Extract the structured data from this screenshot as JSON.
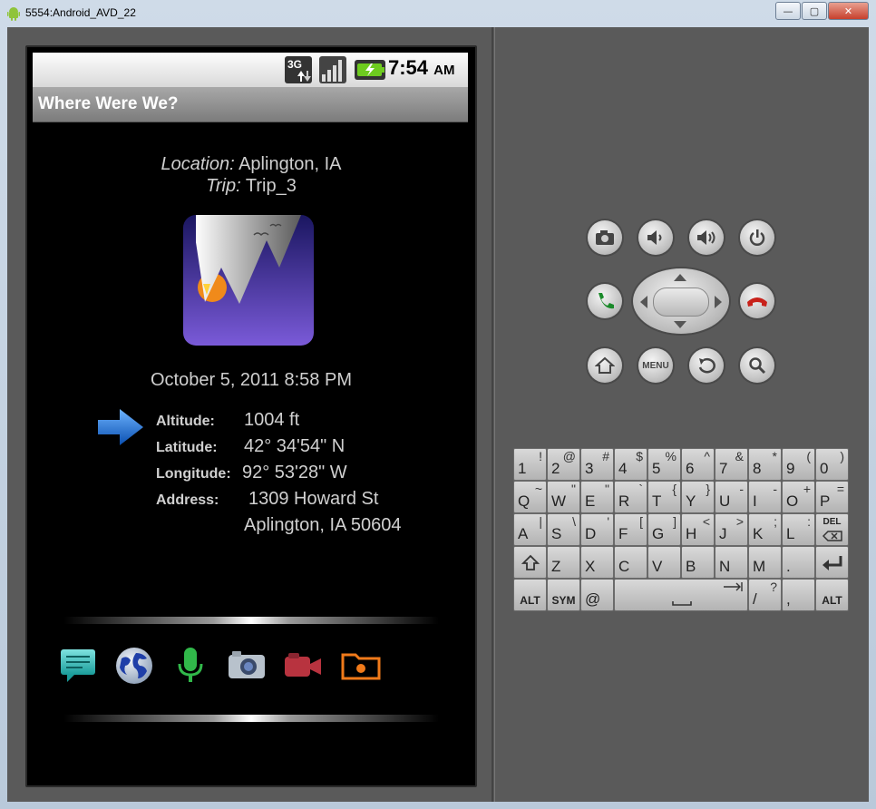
{
  "window": {
    "title": "5554:Android_AVD_22",
    "minimize_glyph": "—",
    "maximize_glyph": "▢",
    "close_glyph": "✕"
  },
  "status_bar": {
    "network": "3G",
    "time": "7:54",
    "ampm": "AM"
  },
  "app": {
    "title": "Where Were We?"
  },
  "location": {
    "label": "Location:",
    "value": "Aplington, IA",
    "trip_label": "Trip:",
    "trip_value": "Trip_3"
  },
  "datetime": "October 5, 2011 8:58 PM",
  "details": {
    "altitude_label": "Altitude:",
    "altitude_value": "1004 ft",
    "latitude_label": "Latitude:",
    "latitude_value": "42° 34'54\" N",
    "longitude_label": "Longitude:",
    "longitude_value": "92° 53'28\" W",
    "address_label": "Address:",
    "address_line1": "1309 Howard St",
    "address_line2": "Aplington, IA 50604"
  },
  "share_icons": [
    "message-icon",
    "globe-icon",
    "microphone-icon",
    "camera-icon",
    "video-camera-icon",
    "folder-icon"
  ],
  "controls": {
    "menu_label": "MENU"
  },
  "keyboard": {
    "row1": [
      [
        "1",
        "!"
      ],
      [
        "2",
        "@"
      ],
      [
        "3",
        "#"
      ],
      [
        "4",
        "$"
      ],
      [
        "5",
        "%"
      ],
      [
        "6",
        "^"
      ],
      [
        "7",
        "&"
      ],
      [
        "8",
        "*"
      ],
      [
        "9",
        "("
      ],
      [
        "0",
        ")"
      ]
    ],
    "row2": [
      [
        "Q",
        "~"
      ],
      [
        "W",
        "\""
      ],
      [
        "E",
        "\""
      ],
      [
        "R",
        "`"
      ],
      [
        "T",
        "{"
      ],
      [
        "Y",
        "}"
      ],
      [
        "U",
        "-"
      ],
      [
        "I",
        "-"
      ],
      [
        "O",
        "+"
      ],
      [
        "P",
        "="
      ]
    ],
    "row3": [
      [
        "A",
        "|"
      ],
      [
        "S",
        "\\"
      ],
      [
        "D",
        "'"
      ],
      [
        "F",
        "["
      ],
      [
        "G",
        "]"
      ],
      [
        "H",
        "<"
      ],
      [
        "J",
        ">"
      ],
      [
        "K",
        ";"
      ],
      [
        "L",
        ":"
      ]
    ],
    "row3_del": "DEL",
    "row4": [
      [
        "Z",
        ""
      ],
      [
        "X",
        ""
      ],
      [
        "C",
        ""
      ],
      [
        "V",
        ""
      ],
      [
        "B",
        ""
      ],
      [
        "N",
        ""
      ],
      [
        "M",
        ""
      ],
      [
        ".",
        ""
      ]
    ],
    "row5_alt": "ALT",
    "row5_sym": "SYM",
    "row5_at": "@",
    "row5_slash": "/",
    "row5_slash_sub": "?",
    "row5_comma": ",",
    "row5_alt2": "ALT"
  }
}
